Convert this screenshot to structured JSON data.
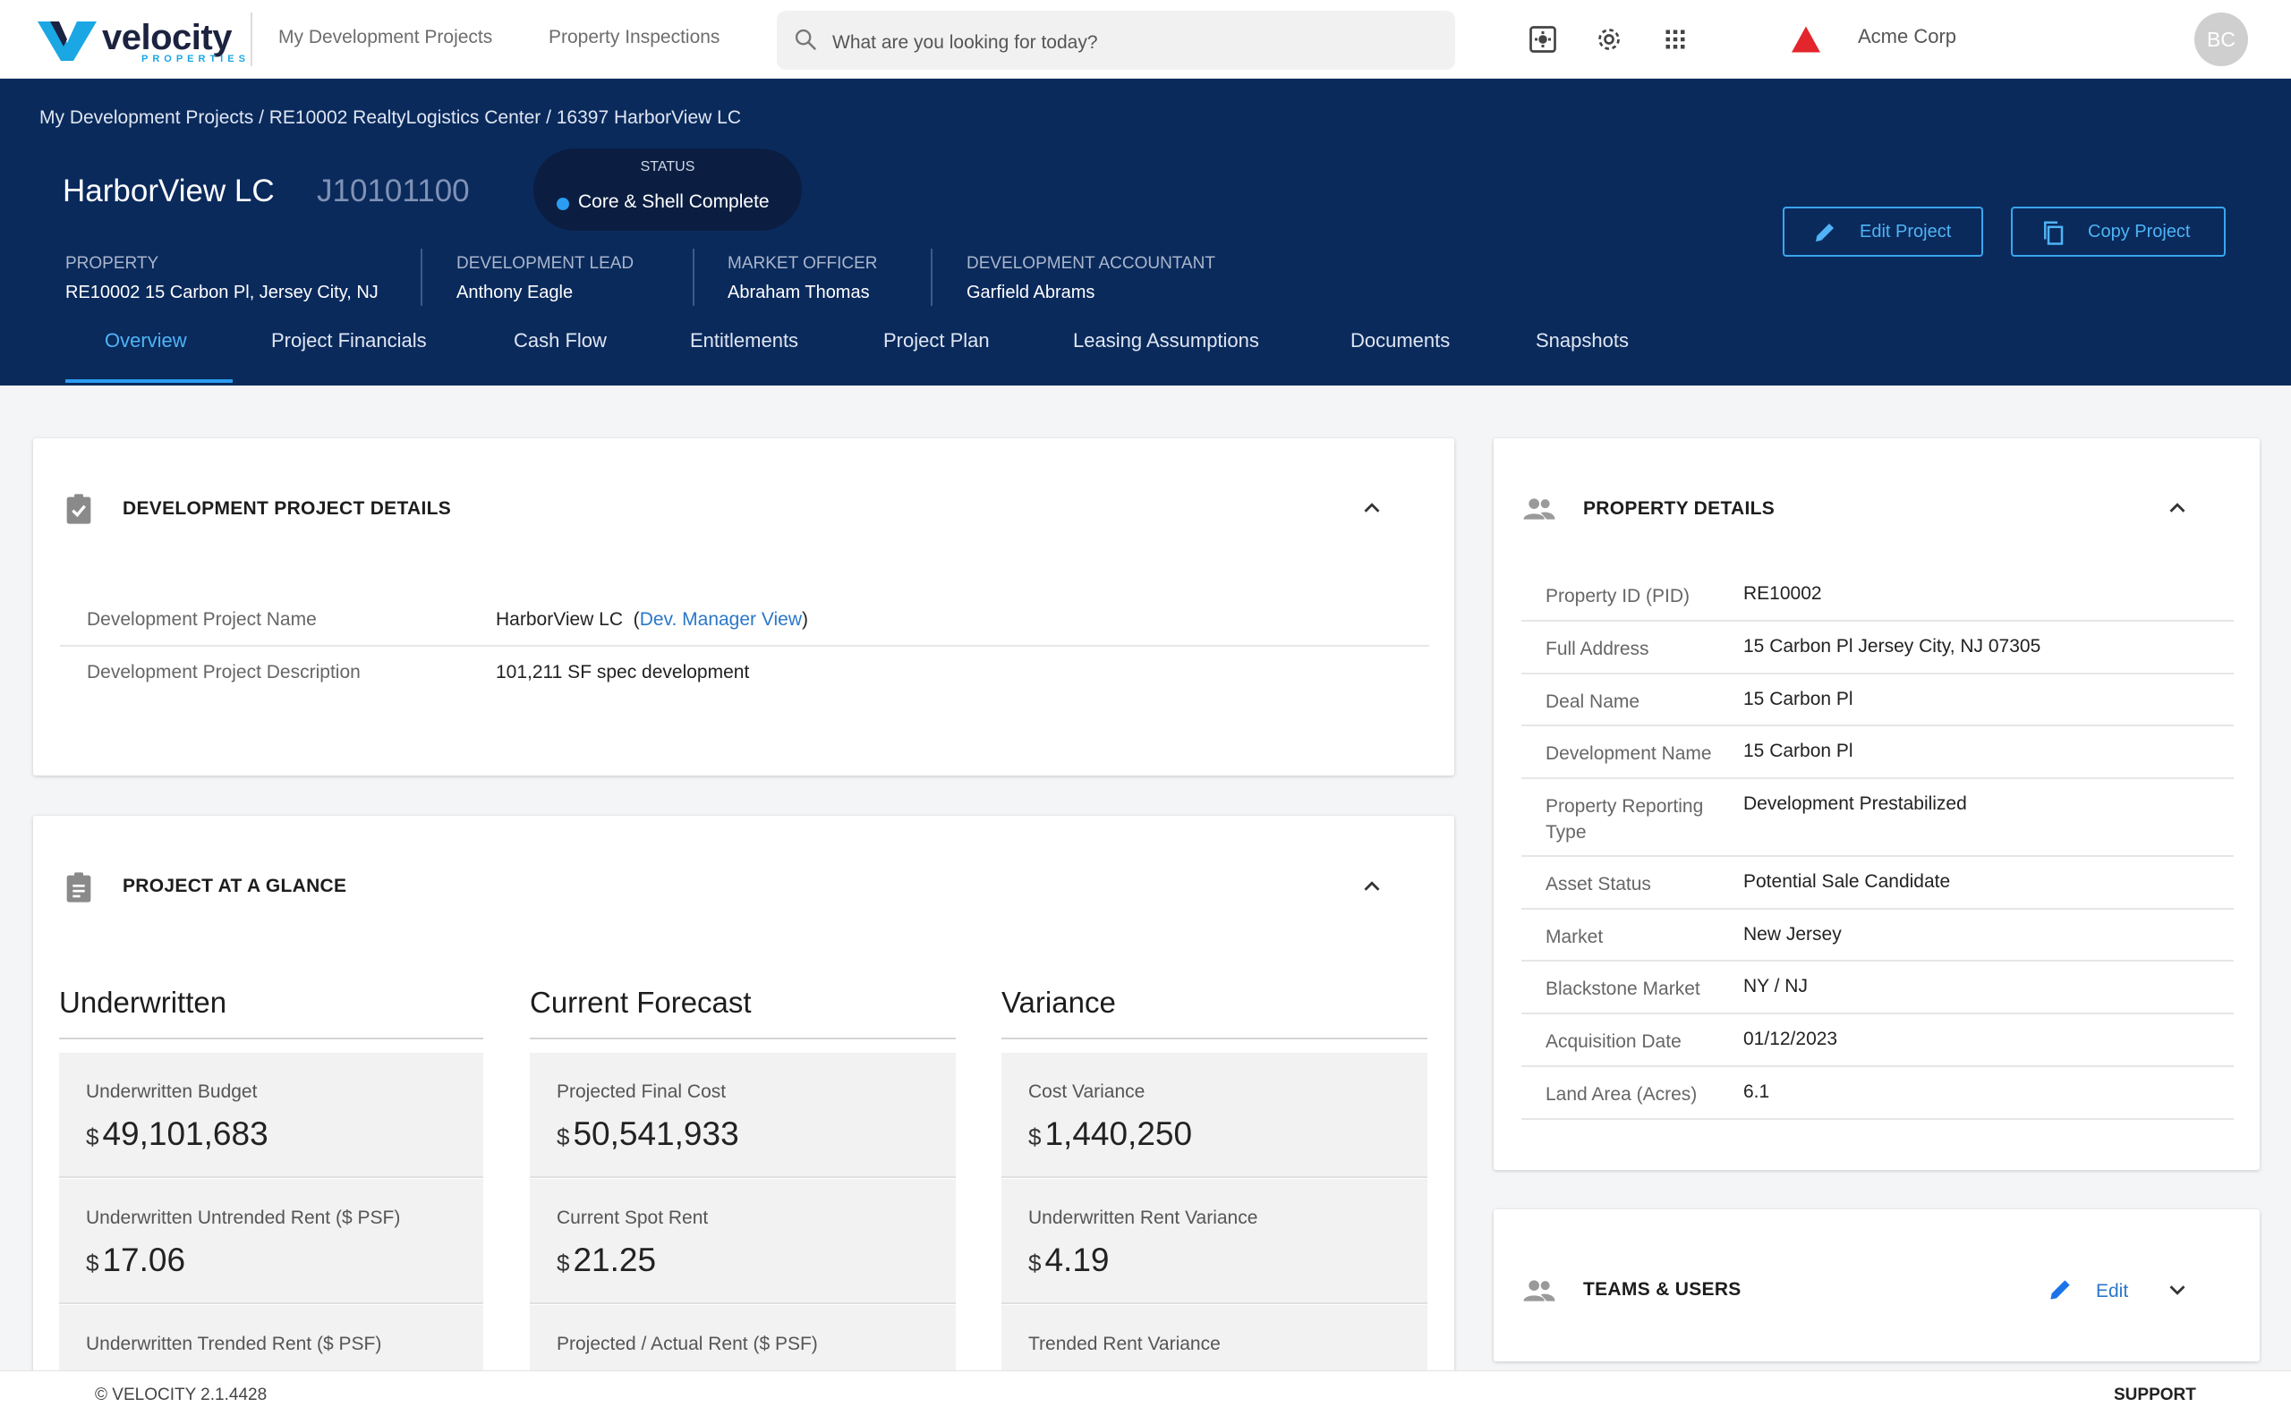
{
  "brand": {
    "name": "velocity",
    "tagline": "PROPERTIES",
    "accent": "#1aa7e3",
    "dark": "#1c2340"
  },
  "topnav": {
    "links": [
      "My Development Projects",
      "Property Inspections"
    ],
    "search_placeholder": "What are you looking for today?",
    "icons": [
      "admin-panel-icon",
      "gear-icon",
      "apps-grid-icon",
      "alert-triangle-icon"
    ],
    "org": "Acme Corp",
    "avatar_initials": "BC"
  },
  "header": {
    "background": "#0a2a5c",
    "breadcrumb": "My Development Projects / RE10002 RealtyLogistics Center / 16397 HarborView LC",
    "title": "HarborView LC",
    "code": "J10101100",
    "status_label": "STATUS",
    "status_value": "Core & Shell Complete",
    "status_color": "#2b9cf2",
    "meta": [
      {
        "label": "PROPERTY",
        "value": "RE10002 15 Carbon Pl, Jersey City, NJ"
      },
      {
        "label": "DEVELOPMENT LEAD",
        "value": "Anthony Eagle"
      },
      {
        "label": "MARKET OFFICER",
        "value": "Abraham Thomas"
      },
      {
        "label": "DEVELOPMENT ACCOUNTANT",
        "value": "Garfield Abrams"
      }
    ],
    "edit_button": "Edit Project",
    "copy_button": "Copy Project",
    "tabs": [
      "Overview",
      "Project Financials",
      "Cash Flow",
      "Entitlements",
      "Project Plan",
      "Leasing Assumptions",
      "Documents",
      "Snapshots"
    ],
    "active_tab": "Overview"
  },
  "dev_details": {
    "title": "DEVELOPMENT PROJECT DETAILS",
    "rows": [
      {
        "label": "Development Project Name",
        "value": "HarborView LC",
        "link": "Dev. Manager View"
      },
      {
        "label": "Development Project Description",
        "value": "101,211 SF spec development"
      }
    ]
  },
  "glance": {
    "title": "PROJECT AT A GLANCE",
    "currency": "$",
    "columns": [
      {
        "heading": "Underwritten",
        "metrics": [
          {
            "label": "Underwritten Budget",
            "value": "49,101,683"
          },
          {
            "label": "Underwritten Untrended Rent ($ PSF)",
            "value": "17.06"
          },
          {
            "label": "Underwritten Trended Rent ($ PSF)",
            "value": ""
          }
        ]
      },
      {
        "heading": "Current Forecast",
        "metrics": [
          {
            "label": "Projected Final Cost",
            "value": "50,541,933"
          },
          {
            "label": "Current Spot Rent",
            "value": "21.25"
          },
          {
            "label": "Projected / Actual Rent ($ PSF)",
            "value": ""
          }
        ]
      },
      {
        "heading": "Variance",
        "metrics": [
          {
            "label": "Cost Variance",
            "value": "1,440,250"
          },
          {
            "label": "Underwritten Rent Variance",
            "value": "4.19"
          },
          {
            "label": "Trended Rent Variance",
            "value": ""
          }
        ]
      }
    ]
  },
  "property_details": {
    "title": "PROPERTY DETAILS",
    "rows": [
      {
        "label": "Property ID (PID)",
        "value": "RE10002"
      },
      {
        "label": "Full Address",
        "value": "15 Carbon Pl Jersey City, NJ 07305"
      },
      {
        "label": "Deal Name",
        "value": "15 Carbon Pl"
      },
      {
        "label": "Development Name",
        "value": "15 Carbon Pl"
      },
      {
        "label": "Property Reporting Type",
        "value": "Development Prestabilized"
      },
      {
        "label": "Asset Status",
        "value": "Potential Sale Candidate"
      },
      {
        "label": "Market",
        "value": "New Jersey"
      },
      {
        "label": "Blackstone Market",
        "value": "NY / NJ"
      },
      {
        "label": "Acquisition Date",
        "value": "01/12/2023"
      },
      {
        "label": "Land Area (Acres)",
        "value": "6.1"
      }
    ]
  },
  "teams": {
    "title": "TEAMS & USERS",
    "edit_label": "Edit"
  },
  "footer": {
    "copyright": "© VELOCITY 2.1.4428",
    "support": "SUPPORT"
  }
}
